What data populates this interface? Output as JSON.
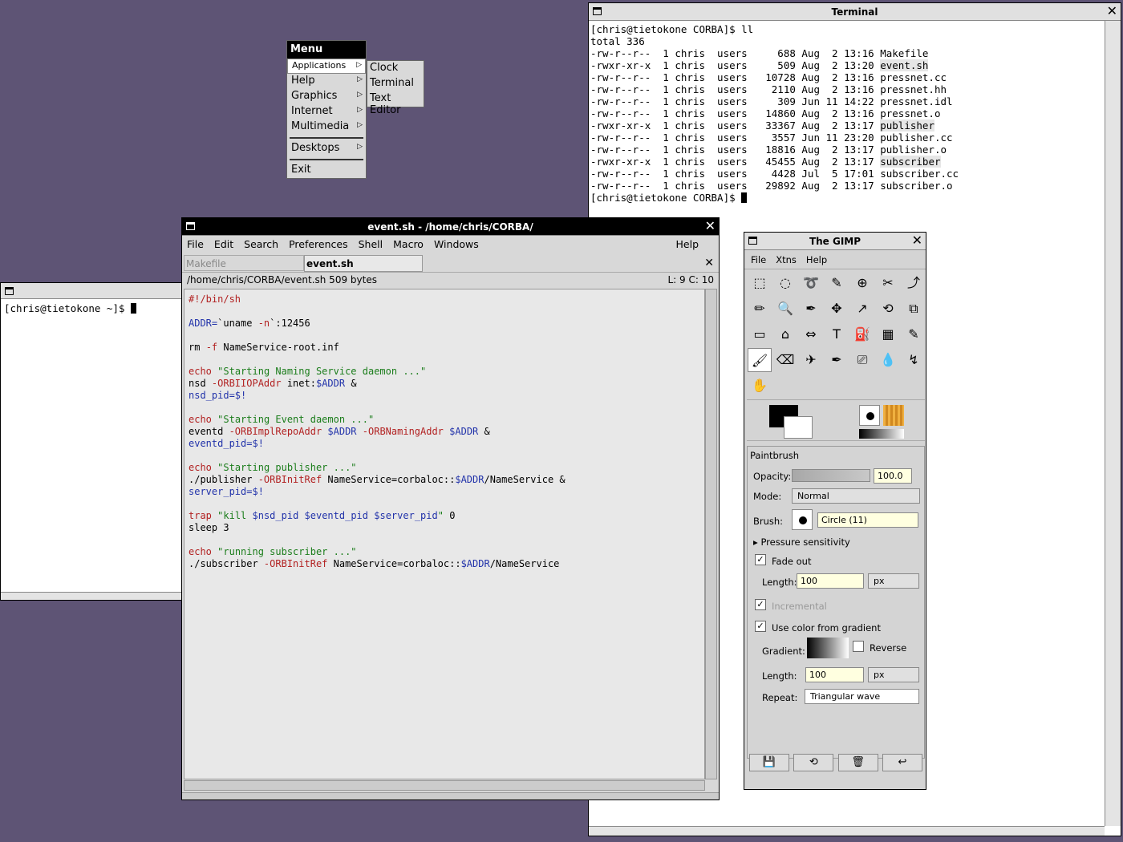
{
  "menu": {
    "title": "Menu",
    "items": [
      "Applications",
      "Help",
      "Graphics",
      "Internet",
      "Multimedia",
      "Desktops",
      "Exit"
    ],
    "submenu": [
      "Clock",
      "Terminal",
      "Text Editor"
    ]
  },
  "terminal": {
    "title": "Terminal",
    "prompt": "[chris@tietokone CORBA]$ ll",
    "total": "total 336",
    "rows": [
      [
        "-rw-r--r--",
        "1",
        "chris",
        "users",
        "688",
        "Aug  2 13:16",
        "Makefile"
      ],
      [
        "-rwxr-xr-x",
        "1",
        "chris",
        "users",
        "509",
        "Aug  2 13:20",
        "event.sh"
      ],
      [
        "-rw-r--r--",
        "1",
        "chris",
        "users",
        "10728",
        "Aug  2 13:16",
        "pressnet.cc"
      ],
      [
        "-rw-r--r--",
        "1",
        "chris",
        "users",
        "2110",
        "Aug  2 13:16",
        "pressnet.hh"
      ],
      [
        "-rw-r--r--",
        "1",
        "chris",
        "users",
        "309",
        "Jun 11 14:22",
        "pressnet.idl"
      ],
      [
        "-rw-r--r--",
        "1",
        "chris",
        "users",
        "14860",
        "Aug  2 13:16",
        "pressnet.o"
      ],
      [
        "-rwxr-xr-x",
        "1",
        "chris",
        "users",
        "33367",
        "Aug  2 13:17",
        "publisher"
      ],
      [
        "-rw-r--r--",
        "1",
        "chris",
        "users",
        "3557",
        "Jun 11 23:20",
        "publisher.cc"
      ],
      [
        "-rw-r--r--",
        "1",
        "chris",
        "users",
        "18816",
        "Aug  2 13:17",
        "publisher.o"
      ],
      [
        "-rwxr-xr-x",
        "1",
        "chris",
        "users",
        "45455",
        "Aug  2 13:17",
        "subscriber"
      ],
      [
        "-rw-r--r--",
        "1",
        "chris",
        "users",
        "4428",
        "Jul  5 17:01",
        "subscriber.cc"
      ],
      [
        "-rw-r--r--",
        "1",
        "chris",
        "users",
        "29892",
        "Aug  2 13:17",
        "subscriber.o"
      ]
    ],
    "end_prompt": "[chris@tietokone CORBA]$ "
  },
  "left_terminal": {
    "prompt": "[chris@tietokone ~]$ "
  },
  "editor": {
    "title": "event.sh - /home/chris/CORBA/",
    "menus": [
      "File",
      "Edit",
      "Search",
      "Preferences",
      "Shell",
      "Macro",
      "Windows"
    ],
    "help": "Help",
    "tab_inactive": "Makefile",
    "tab_active": "event.sh",
    "path": "/home/chris/CORBA/event.sh 509 bytes",
    "position": "L: 9  C: 10",
    "lines": [
      "#!/bin/sh",
      "",
      "ADDR=`uname -n`:12456",
      "",
      "rm -f NameService-root.inf",
      "",
      "echo \"Starting Naming Service daemon ...\"",
      "nsd -ORBIIOPAddr inet:$ADDR &",
      "nsd_pid=$!",
      "",
      "echo \"Starting Event daemon ...\"",
      "eventd -ORBImplRepoAddr $ADDR -ORBNamingAddr $ADDR &",
      "eventd_pid=$!",
      "",
      "echo \"Starting publisher ...\"",
      "./publisher -ORBInitRef NameService=corbaloc::$ADDR/NameService &",
      "server_pid=$!",
      "",
      "trap \"kill $nsd_pid $eventd_pid $server_pid\" 0",
      "sleep 3",
      "",
      "echo \"running subscriber ...\"",
      "./subscriber -ORBInitRef NameService=corbaloc::$ADDR/NameService"
    ]
  },
  "gimp": {
    "title": "The GIMP",
    "menus": [
      "File",
      "Xtns",
      "Help"
    ],
    "tool_options_title": "Paintbrush",
    "opacity_label": "Opacity:",
    "opacity_value": "100.0",
    "mode_label": "Mode:",
    "mode_value": "Normal",
    "brush_label": "Brush:",
    "brush_value": "Circle (11)",
    "pressure": "Pressure sensitivity",
    "fade_out": "Fade out",
    "length_label": "Length:",
    "fade_length": "100",
    "unit": "px",
    "incremental": "Incremental",
    "use_gradient": "Use color from gradient",
    "gradient_label": "Gradient:",
    "reverse": "Reverse",
    "grad_length": "100",
    "repeat_label": "Repeat:",
    "repeat_value": "Triangular wave",
    "opacity_level": 1.0
  }
}
